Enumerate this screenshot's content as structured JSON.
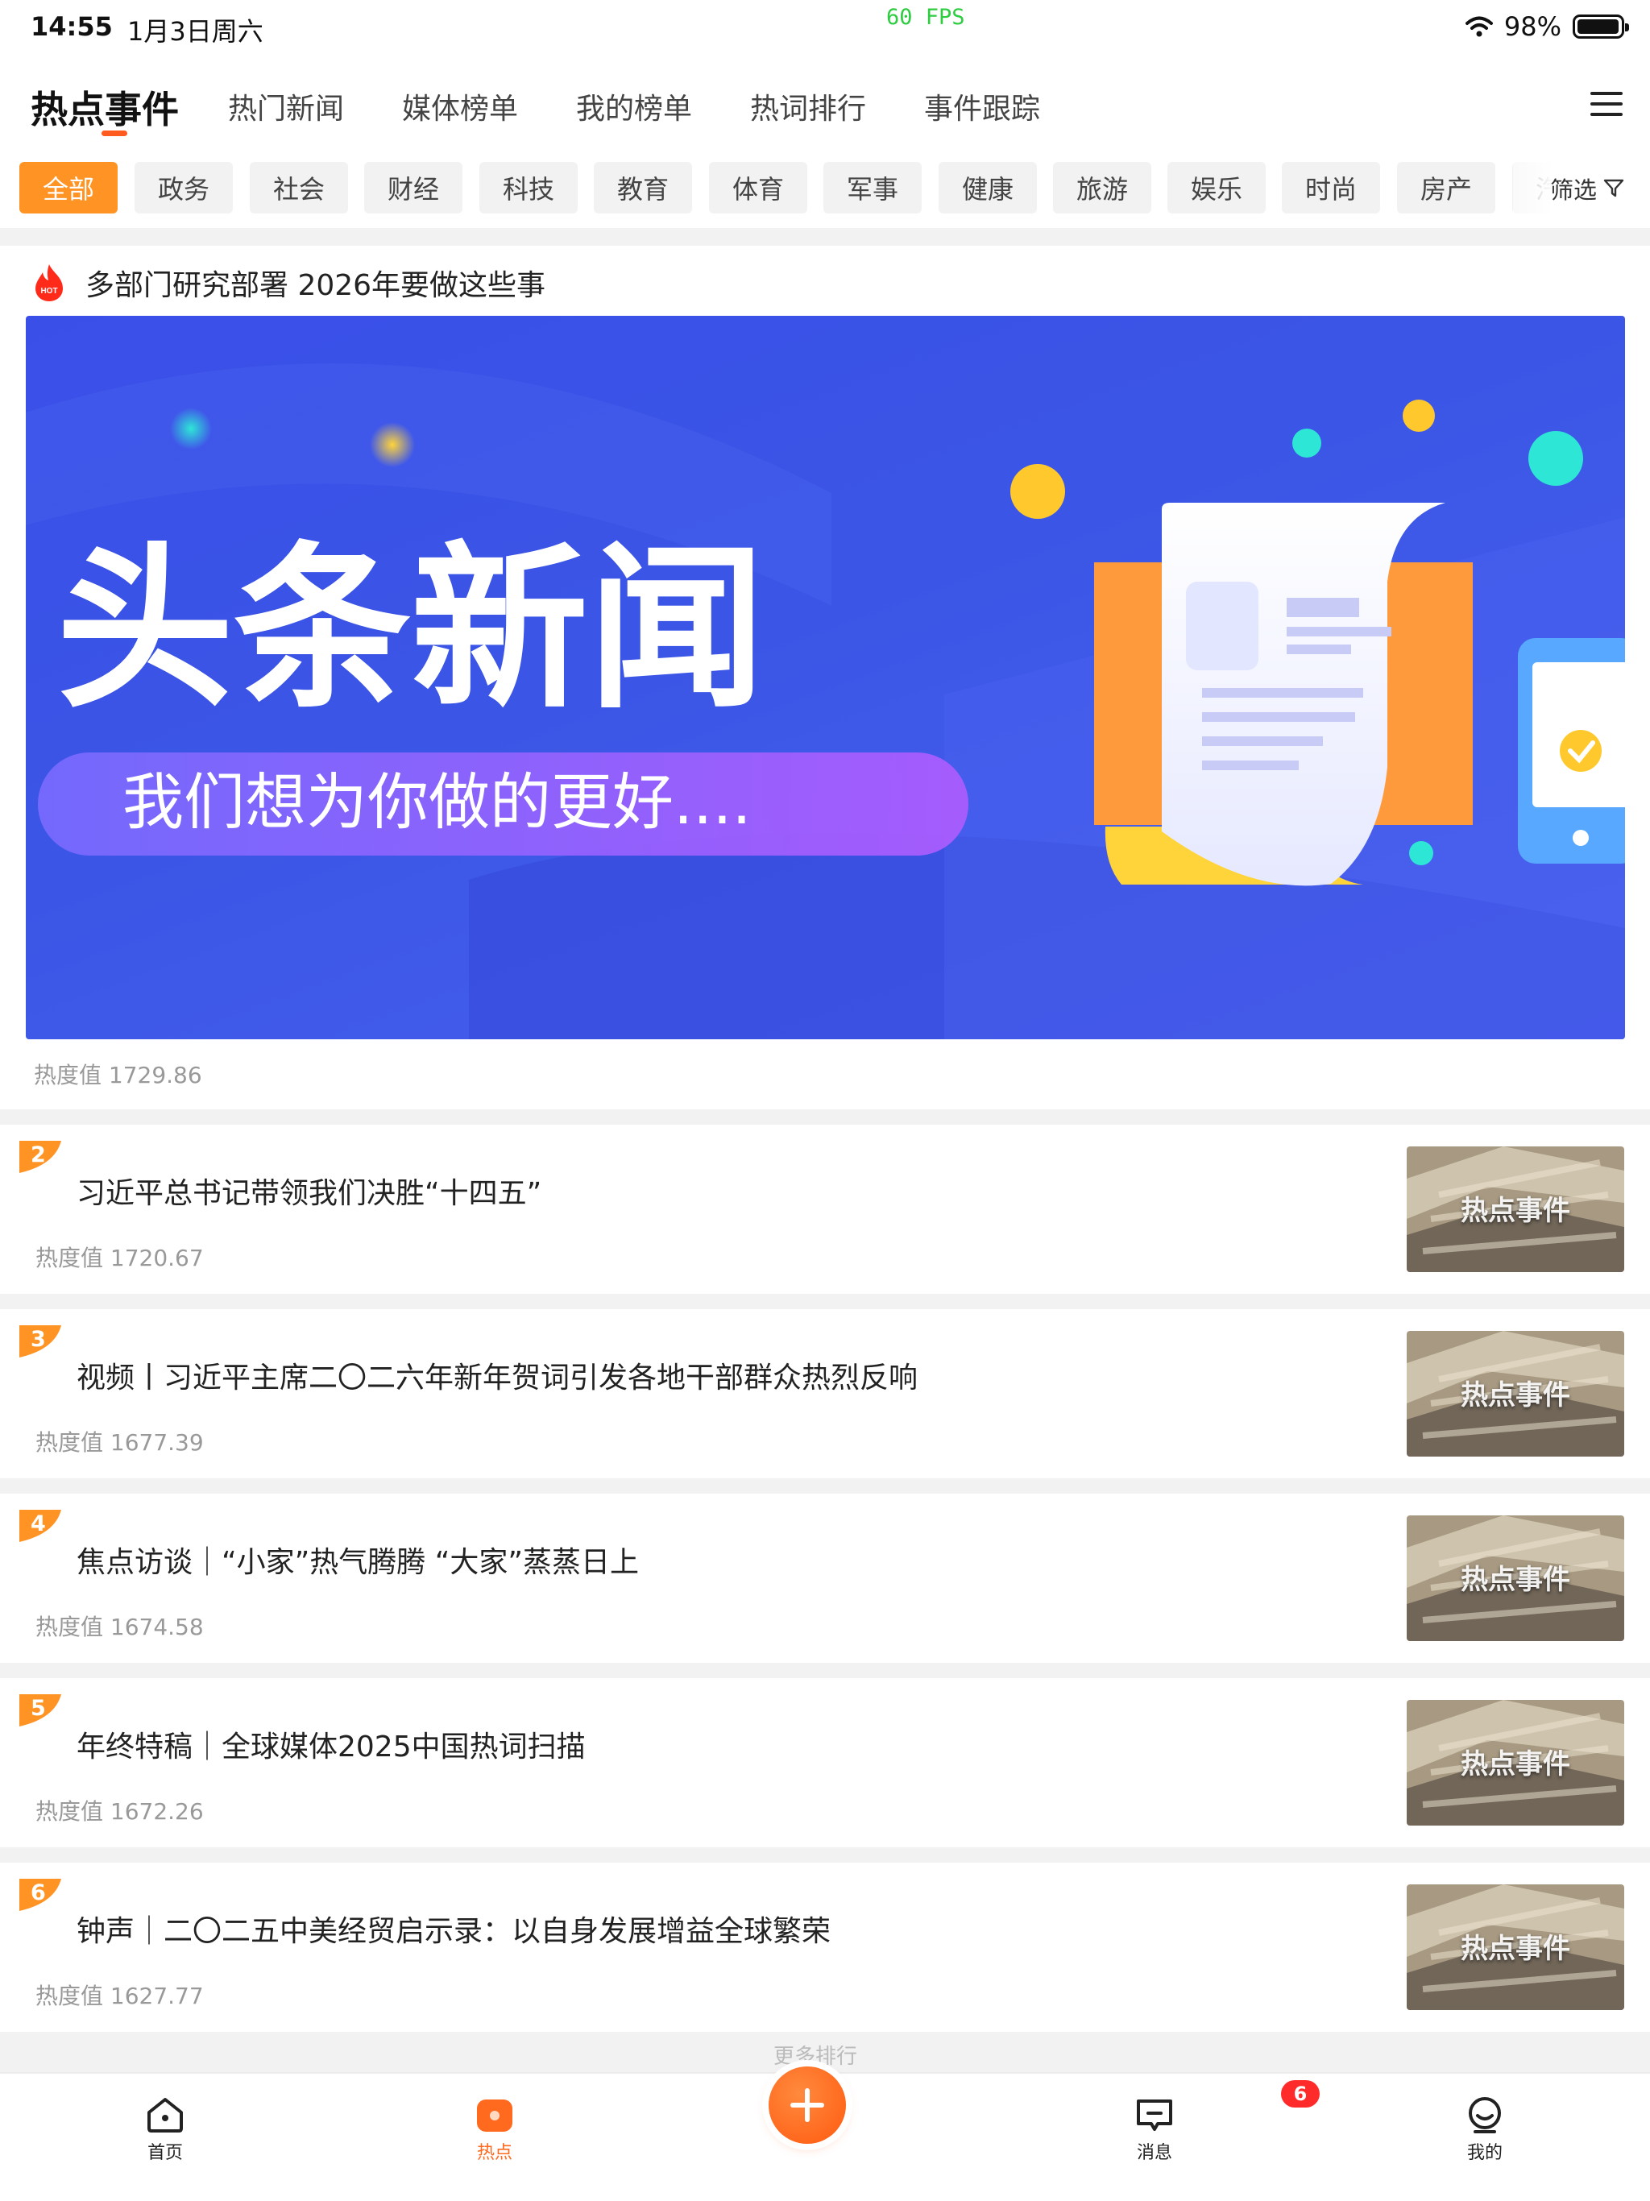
{
  "status_bar": {
    "time": "14:55",
    "date": "1月3日周六",
    "fps": "60 FPS",
    "battery": "98%",
    "battery_level": 0.98
  },
  "top_tabs": [
    {
      "label": "热点事件",
      "active": true
    },
    {
      "label": "热门新闻"
    },
    {
      "label": "媒体榜单"
    },
    {
      "label": "我的榜单"
    },
    {
      "label": "热词排行"
    },
    {
      "label": "事件跟踪"
    }
  ],
  "categories": [
    "全部",
    "政务",
    "社会",
    "财经",
    "科技",
    "教育",
    "体育",
    "军事",
    "健康",
    "旅游",
    "娱乐",
    "时尚",
    "房产",
    "汽车"
  ],
  "filter_label": "筛选",
  "hero": {
    "hot_badge": "HOT",
    "title": "多部门研究部署 2026年要做这些事",
    "banner_headline": "头条新闻",
    "banner_slogan": "我们想为你做的更好....",
    "heat": "热度值 1729.86"
  },
  "thumb_label": "热点事件",
  "items": [
    {
      "rank": "2",
      "title": "习近平总书记带领我们决胜“十四五”",
      "heat": "热度值 1720.67"
    },
    {
      "rank": "3",
      "title": "视频丨习近平主席二〇二六年新年贺词引发各地干部群众热烈反响",
      "heat": "热度值 1677.39"
    },
    {
      "rank": "4",
      "title": "焦点访谈｜“小家”热气腾腾 “大家”蒸蒸日上",
      "heat": "热度值 1674.58"
    },
    {
      "rank": "5",
      "title": "年终特稿｜全球媒体2025中国热词扫描",
      "heat": "热度值 1672.26"
    },
    {
      "rank": "6",
      "title": "钟声｜二〇二五中美经贸启示录：以自身发展增益全球繁荣",
      "heat": "热度值 1627.77"
    }
  ],
  "more_label": "更多排行",
  "tabbar": {
    "home": "首页",
    "hot": "热点",
    "messages": "消息",
    "mine": "我的",
    "message_badge": "6"
  },
  "colors": {
    "accent": "#ff9424",
    "primary_orange": "#ff5a10",
    "banner_blue": "#3b56e6"
  }
}
